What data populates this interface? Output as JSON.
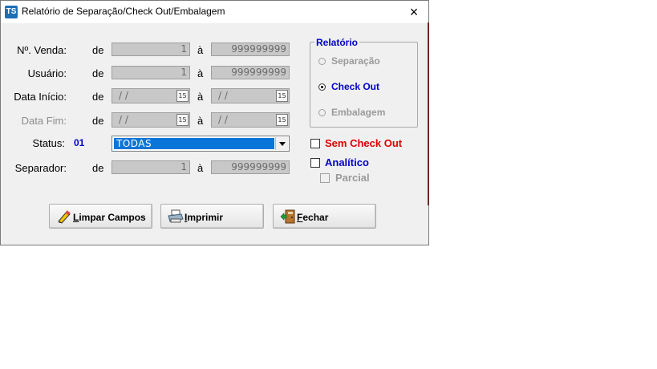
{
  "window": {
    "title": "Relatório de Separação/Check Out/Embalagem",
    "app_icon": "TS",
    "close": "×"
  },
  "rows": {
    "venda": {
      "label": "Nº. Venda:",
      "de": "de",
      "from": "1",
      "a": "à",
      "to": "999999999"
    },
    "usuario": {
      "label": "Usuário:",
      "de": "de",
      "from": "1",
      "a": "à",
      "to": "999999999"
    },
    "data_inicio": {
      "label": "Data Início:",
      "de": "de",
      "from": "/ /",
      "a": "à",
      "to": "/ /",
      "cal": "15"
    },
    "data_fim": {
      "label": "Data Fim:",
      "de": "de",
      "from": "/ /",
      "a": "à",
      "to": "/ /",
      "cal": "15"
    },
    "status": {
      "label": "Status:",
      "code": "01",
      "selected": "TODAS"
    },
    "separador": {
      "label": "Separador:",
      "de": "de",
      "from": "1",
      "a": "à",
      "to": "999999999"
    }
  },
  "relatorio": {
    "title": "Relatório",
    "options": [
      {
        "label": "Separação",
        "selected": false,
        "enabled": false
      },
      {
        "label": "Check Out",
        "selected": true,
        "enabled": true
      },
      {
        "label": "Embalagem",
        "selected": false,
        "enabled": false
      }
    ]
  },
  "checks": {
    "sem_check_out": {
      "label": "Sem Check Out",
      "color": "#e00000",
      "checked": false
    },
    "analitico": {
      "label": "Analítico",
      "color": "#0000c8",
      "checked": false
    },
    "parcial": {
      "label": "Parcial",
      "enabled": false,
      "checked": false
    }
  },
  "buttons": {
    "limpar": {
      "mnemonic": "L",
      "rest": "impar Campos",
      "icon": "eraser-pencil-icon"
    },
    "imprimir": {
      "mnemonic": "I",
      "rest": "mprimir",
      "icon": "printer-icon"
    },
    "fechar": {
      "mnemonic": "F",
      "rest": "echar",
      "icon": "exit-door-icon"
    }
  }
}
